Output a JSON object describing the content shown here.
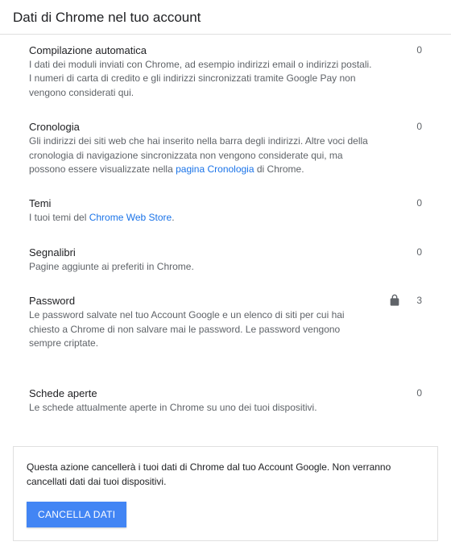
{
  "header": {
    "title": "Dati di Chrome nel tuo account"
  },
  "items": [
    {
      "title": "Compilazione automatica",
      "desc": "I dati dei moduli inviati con Chrome, ad esempio indirizzi email o indirizzi postali. I numeri di carta di credito e gli indirizzi sincronizzati tramite Google Pay non vengono considerati qui.",
      "count": "0",
      "lock": false
    },
    {
      "title": "Cronologia",
      "desc_pre": "Gli indirizzi dei siti web che hai inserito nella barra degli indirizzi. Altre voci della cronologia di navigazione sincronizzata non vengono considerate qui, ma possono essere visualizzate nella ",
      "desc_link": "pagina Cronologia",
      "desc_post": " di Chrome.",
      "count": "0",
      "lock": false,
      "has_link": true
    },
    {
      "title": "Temi",
      "desc_pre": "I tuoi temi del ",
      "desc_link": "Chrome Web Store",
      "desc_post": ".",
      "count": "0",
      "lock": false,
      "has_link": true
    },
    {
      "title": "Segnalibri",
      "desc": "Pagine aggiunte ai preferiti in Chrome.",
      "count": "0",
      "lock": false
    },
    {
      "title": "Password",
      "desc": "Le password salvate nel tuo Account Google e un elenco di siti per cui hai chiesto a Chrome di non salvare mai le password. Le password vengono sempre criptate.",
      "count": "3",
      "lock": true
    },
    {
      "title": "Schede aperte",
      "desc": "Le schede attualmente aperte in Chrome su uno dei tuoi dispositivi.",
      "count": "0",
      "lock": false
    }
  ],
  "footer": {
    "text": "Questa azione cancellerà i tuoi dati di Chrome dal tuo Account Google. Non verranno cancellati dati dai tuoi dispositivi.",
    "button": "CANCELLA DATI"
  }
}
